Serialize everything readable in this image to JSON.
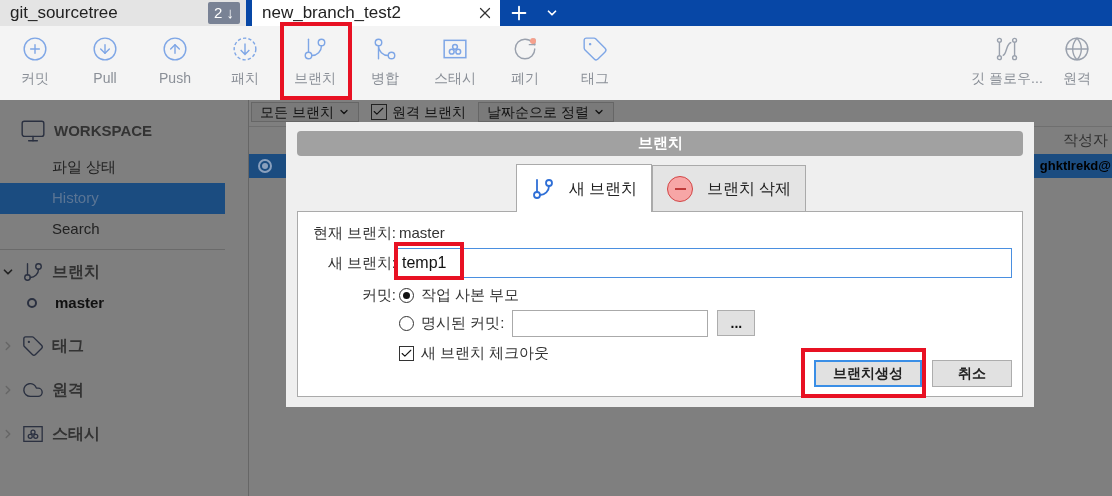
{
  "tabs": [
    {
      "label": "git_sourcetree",
      "badge": "2 ↓",
      "selected": false
    },
    {
      "label": "new_branch_test2",
      "selected": true
    }
  ],
  "toolbar": {
    "left": [
      {
        "label": "커밋",
        "kind": "commit",
        "highlighted": false
      },
      {
        "label": "Pull",
        "kind": "pull",
        "highlighted": false
      },
      {
        "label": "Push",
        "kind": "push",
        "highlighted": false
      },
      {
        "label": "패치",
        "kind": "patch",
        "highlighted": false
      },
      {
        "label": "브랜치",
        "kind": "branch",
        "highlighted": true
      },
      {
        "label": "병합",
        "kind": "merge",
        "highlighted": false
      },
      {
        "label": "스태시",
        "kind": "stash",
        "highlighted": false
      },
      {
        "label": "폐기",
        "kind": "discard",
        "highlighted": false
      },
      {
        "label": "태그",
        "kind": "tag",
        "highlighted": false
      }
    ],
    "right": [
      {
        "label": "깃 플로우...",
        "kind": "gitflow",
        "highlighted": false
      },
      {
        "label": "원격",
        "kind": "remote",
        "highlighted": false
      }
    ]
  },
  "sidebar": {
    "workspace": {
      "title": "WORKSPACE",
      "items": [
        {
          "label": "파일 상태",
          "selected": false
        },
        {
          "label": "History",
          "selected": true
        },
        {
          "label": "Search",
          "selected": false
        }
      ]
    },
    "sections": [
      {
        "label": "브랜치",
        "kind": "branch",
        "expanded": true,
        "children": [
          {
            "label": "master"
          }
        ]
      },
      {
        "label": "태그",
        "kind": "tag",
        "expanded": false
      },
      {
        "label": "원격",
        "kind": "remote",
        "expanded": false
      },
      {
        "label": "스태시",
        "kind": "stash",
        "expanded": false
      }
    ]
  },
  "filters": [
    {
      "kind": "dropdown",
      "label": "모든 브랜치"
    },
    {
      "kind": "checkbox",
      "label": "원격 브랜치",
      "checked": true
    },
    {
      "kind": "dropdown",
      "label": "날짜순으로 정렬"
    }
  ],
  "table": {
    "columns": [
      "작성자"
    ],
    "rows": [
      {
        "selected": true,
        "author": "ghktlrekd@"
      }
    ]
  },
  "dialog": {
    "title": "브랜치",
    "tabs": [
      {
        "label": "새 브랜치",
        "kind": "new",
        "selected": true
      },
      {
        "label": "브랜치 삭제",
        "kind": "delete",
        "selected": false
      }
    ],
    "current_branch": {
      "label": "현재 브랜치:",
      "value": "master"
    },
    "new_branch": {
      "label": "새 브랜치:",
      "value": "temp1",
      "highlighted": true
    },
    "commit": {
      "label": "커밋:",
      "options": [
        {
          "label": "작업 사본 부모",
          "selected": true
        },
        {
          "label": "명시된 커밋:",
          "selected": false
        }
      ],
      "browse_button": "..."
    },
    "checkout": {
      "label": "새 브랜치 체크아웃",
      "checked": true
    },
    "buttons": [
      {
        "label": "브랜치생성",
        "kind": "primary",
        "highlighted": true
      },
      {
        "label": "취소",
        "kind": "secondary",
        "highlighted": false
      }
    ]
  }
}
